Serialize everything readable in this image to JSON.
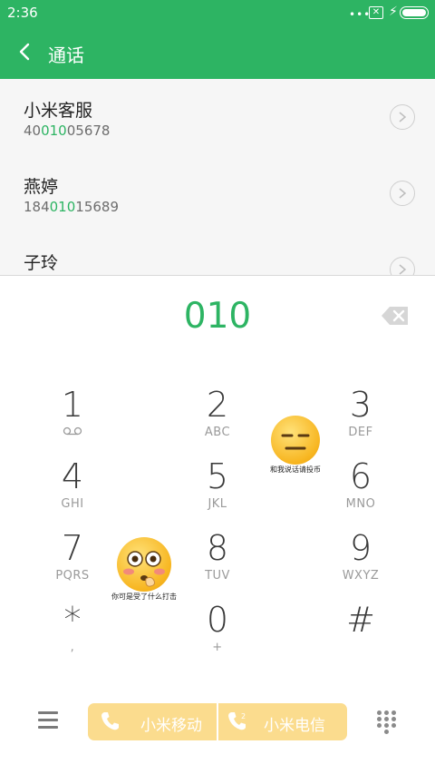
{
  "status_bar": {
    "time": "2:36",
    "dots": "•••",
    "sim_icon": "sim-off-icon",
    "charging_icon": "bolt-icon",
    "battery_icon": "battery-icon"
  },
  "header": {
    "title": "通话",
    "back_icon": "back-arrow-icon"
  },
  "results": [
    {
      "name": "小米客服",
      "number_pre": "40",
      "number_hl": "010",
      "number_post": "05678"
    },
    {
      "name": "燕婷",
      "number_pre": "184",
      "number_hl": "010",
      "number_post": "15689"
    },
    {
      "name": "子玲",
      "number_pre": "",
      "number_hl": "",
      "number_post": ""
    }
  ],
  "dialed_number": "010",
  "keys": [
    {
      "digit": "1",
      "letters": ""
    },
    {
      "digit": "2",
      "letters": "ABC"
    },
    {
      "digit": "3",
      "letters": "DEF"
    },
    {
      "digit": "4",
      "letters": "GHI"
    },
    {
      "digit": "5",
      "letters": "JKL"
    },
    {
      "digit": "6",
      "letters": "MNO"
    },
    {
      "digit": "7",
      "letters": "PQRS"
    },
    {
      "digit": "8",
      "letters": "TUV"
    },
    {
      "digit": "9",
      "letters": "WXYZ"
    },
    {
      "digit": "*",
      "letters": ","
    },
    {
      "digit": "0",
      "letters": "+"
    },
    {
      "digit": "#",
      "letters": ""
    }
  ],
  "stickers": [
    {
      "caption": "和我说话请投币",
      "icon": "expressionless-emoji-icon"
    },
    {
      "caption": "你可是受了什么打击",
      "icon": "flushed-emoji-icon"
    }
  ],
  "bottom": {
    "sim1_label": "小米移动",
    "sim2_label": "小米电信",
    "call_color": "#fbdc8e"
  },
  "colors": {
    "accent": "#2db463"
  }
}
